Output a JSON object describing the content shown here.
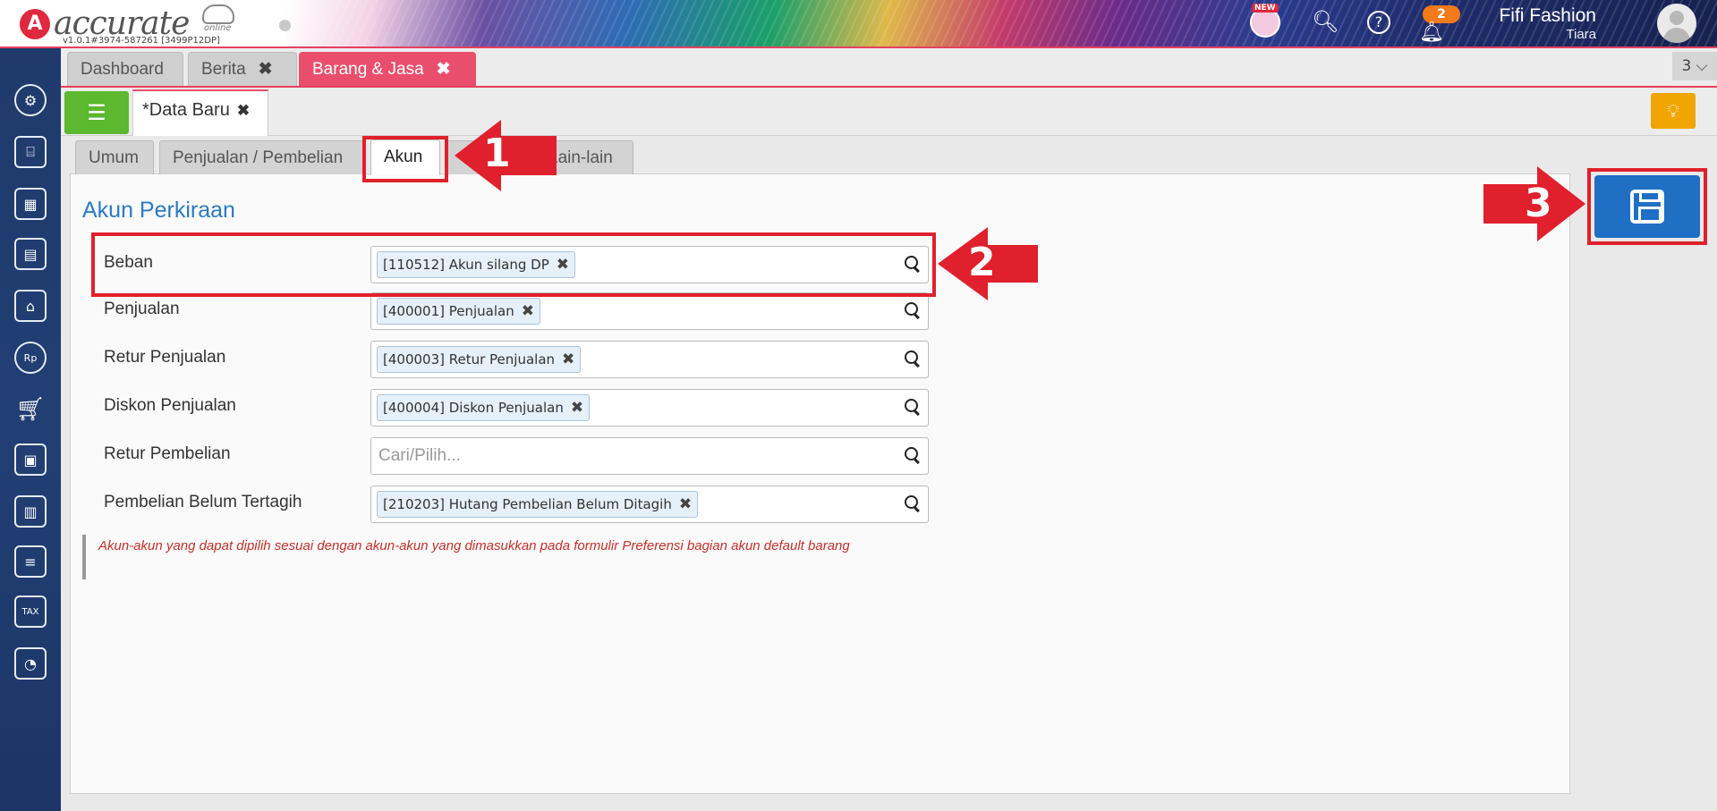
{
  "header": {
    "logo_text": "accurate",
    "logo_sub": "online",
    "version": "v1.0.1#3974-587261 [3499P12DP]",
    "new_label": "NEW",
    "notification_count": "2",
    "user_name": "Fifi Fashion",
    "user_sub": "Tiara"
  },
  "tabs": [
    {
      "label": "Dashboard"
    },
    {
      "label": "Berita"
    },
    {
      "label": "Barang & Jasa"
    }
  ],
  "tab_count": "3",
  "doc_tab": {
    "label": "*Data Baru"
  },
  "subtabs": [
    {
      "label": "Umum"
    },
    {
      "label": "Penjualan / Pembelian"
    },
    {
      "label": "Akun"
    },
    {
      "label": "Lain-lain"
    }
  ],
  "section_title": "Akun Perkiraan",
  "fields": [
    {
      "label": "Beban",
      "value": "[110512] Akun silang DP"
    },
    {
      "label": "Penjualan",
      "value": "[400001] Penjualan"
    },
    {
      "label": "Retur Penjualan",
      "value": "[400003] Retur Penjualan"
    },
    {
      "label": "Diskon Penjualan",
      "value": "[400004] Diskon Penjualan"
    },
    {
      "label": "Retur Pembelian",
      "placeholder": "Cari/Pilih..."
    },
    {
      "label": "Pembelian Belum Tertagih",
      "value": "[210203] Hutang Pembelian Belum Ditagih"
    }
  ],
  "note": "Akun-akun yang dapat dipilih sesuai dengan akun-akun yang dimasukkan pada formulir Preferensi bagian akun default barang",
  "annotations": [
    {
      "label": "1"
    },
    {
      "label": "2"
    },
    {
      "label": "3"
    }
  ],
  "colors": {
    "accent": "#e94f6c",
    "save": "#1f6fc5",
    "annotation": "#e0202c",
    "title": "#2a7ac7"
  }
}
